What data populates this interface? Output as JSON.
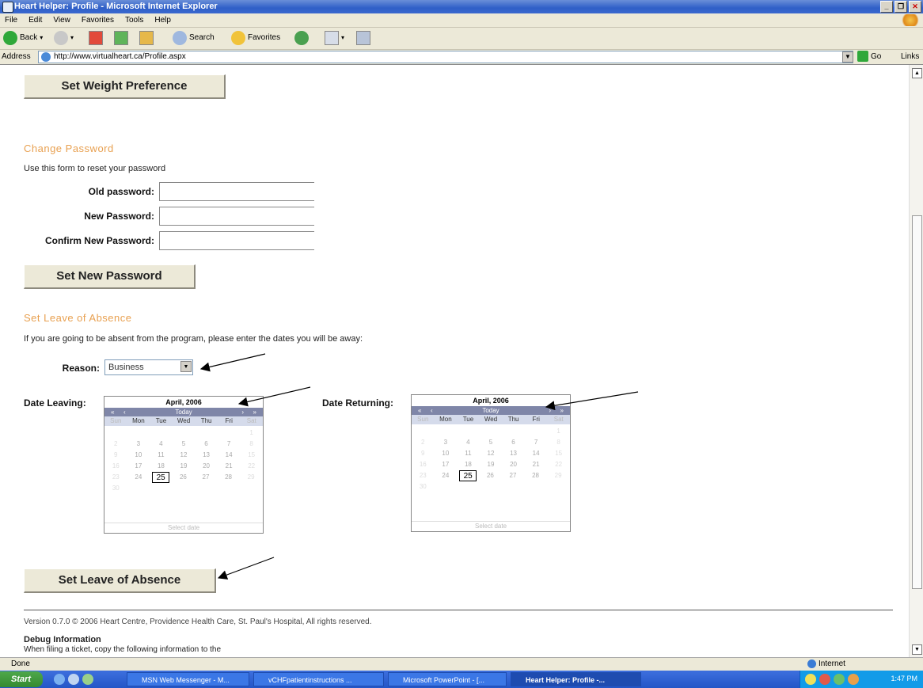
{
  "window": {
    "title": "Heart Helper: Profile - Microsoft Internet Explorer"
  },
  "menu": [
    "File",
    "Edit",
    "View",
    "Favorites",
    "Tools",
    "Help"
  ],
  "toolbar": {
    "back": "Back",
    "search": "Search",
    "favorites": "Favorites"
  },
  "address": {
    "label": "Address",
    "url": "http://www.virtualheart.ca/Profile.aspx",
    "go": "Go",
    "links": "Links"
  },
  "page": {
    "weight_button": "Set Weight Preference",
    "password_section": {
      "title": "Change Password",
      "intro": "Use this form to reset your password",
      "old_label": "Old password:",
      "new_label": "New Password:",
      "confirm_label": "Confirm New Password:",
      "submit": "Set New Password"
    },
    "absence_section": {
      "title": "Set Leave of Absence",
      "intro": "If you are going to be absent from the program, please enter the dates you will be away:",
      "reason_label": "Reason:",
      "reason_value": "Business",
      "leaving_label": "Date Leaving:",
      "returning_label": "Date Returning:",
      "submit": "Set Leave of Absence"
    },
    "calendar": {
      "month": "April, 2006",
      "today": "Today",
      "nav_prev_year": "«",
      "nav_prev": "‹",
      "nav_next": "›",
      "nav_next_year": "»",
      "days": [
        "Sun",
        "Mon",
        "Tue",
        "Wed",
        "Thu",
        "Fri",
        "Sat"
      ],
      "weeks": [
        [
          "",
          "",
          "",
          "",
          "",
          "",
          "1"
        ],
        [
          "2",
          "3",
          "4",
          "5",
          "6",
          "7",
          "8"
        ],
        [
          "9",
          "10",
          "11",
          "12",
          "13",
          "14",
          "15"
        ],
        [
          "16",
          "17",
          "18",
          "19",
          "20",
          "21",
          "22"
        ],
        [
          "23",
          "24",
          "25",
          "26",
          "27",
          "28",
          "29"
        ],
        [
          "30",
          "",
          "",
          "",
          "",
          "",
          ""
        ]
      ],
      "selected": "25",
      "footer": "Select date"
    },
    "footer": "Version 0.7.0 © 2006 Heart Centre, Providence Health Care, St. Paul's Hospital, All rights reserved.",
    "debug_title": "Debug Information",
    "debug_text": "When filing a ticket, copy the following information to the"
  },
  "status": {
    "left": "Done",
    "zone": "Internet"
  },
  "taskbar": {
    "start": "Start",
    "tasks": [
      "MSN Web Messenger - M...",
      "vCHFpatientinstructions ...",
      "Microsoft PowerPoint - [...",
      "Heart Helper: Profile -..."
    ],
    "clock": "1:47 PM"
  }
}
